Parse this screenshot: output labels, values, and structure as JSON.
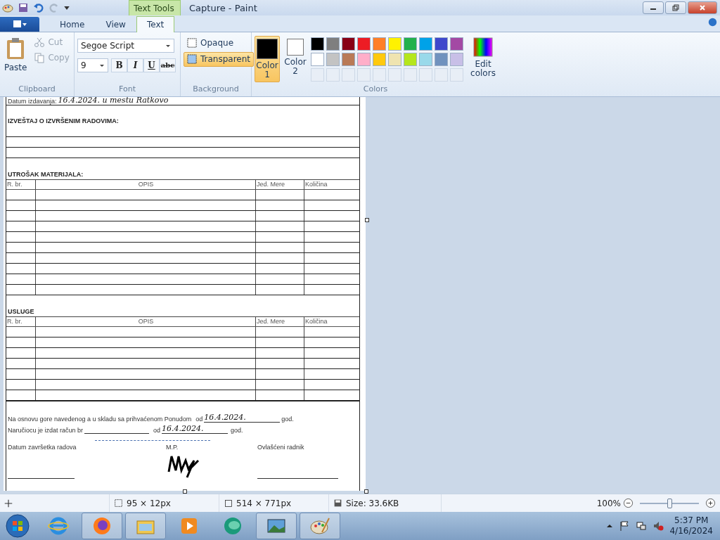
{
  "window": {
    "title": "Capture - Paint",
    "context_tab": "Text Tools"
  },
  "ribbon_tabs": [
    {
      "label": "Home",
      "selected": false
    },
    {
      "label": "View",
      "selected": false
    },
    {
      "label": "Text",
      "selected": true
    }
  ],
  "clipboard": {
    "label": "Clipboard",
    "paste": "Paste",
    "cut": "Cut",
    "copy": "Copy"
  },
  "font": {
    "label": "Font",
    "family": "Segoe Script",
    "size": "9",
    "styles": [
      {
        "kind": "bold",
        "label": "B"
      },
      {
        "kind": "italic",
        "label": "I"
      },
      {
        "kind": "underline",
        "label": "U"
      },
      {
        "kind": "strike",
        "label": "abc"
      }
    ]
  },
  "background": {
    "label": "Background",
    "options": [
      {
        "label": "Opaque",
        "selected": false
      },
      {
        "label": "Transparent",
        "selected": true
      }
    ]
  },
  "colors": {
    "label": "Colors",
    "edit": "Edit colors",
    "slots": [
      {
        "label": "Color 1",
        "color": "#000000",
        "selected": true
      },
      {
        "label": "Color 2",
        "color": "#ffffff",
        "selected": false
      }
    ],
    "palette": [
      {
        "color": "#000000"
      },
      {
        "color": "#7f7f7f"
      },
      {
        "color": "#880015"
      },
      {
        "color": "#ed1c24"
      },
      {
        "color": "#ff7f27"
      },
      {
        "color": "#fff200"
      },
      {
        "color": "#22b14c"
      },
      {
        "color": "#00a2e8"
      },
      {
        "color": "#3f48cc"
      },
      {
        "color": "#a349a4"
      },
      {
        "color": "#ffffff"
      },
      {
        "color": "#c3c3c3"
      },
      {
        "color": "#b97a57"
      },
      {
        "color": "#ffaec9"
      },
      {
        "color": "#ffc90e"
      },
      {
        "color": "#efe4b0"
      },
      {
        "color": "#b5e61d"
      },
      {
        "color": "#99d9ea"
      },
      {
        "color": "#7092be"
      },
      {
        "color": "#c8bfe7"
      }
    ]
  },
  "document": {
    "issue_label": "Datum izdavanja:",
    "issue_value": "16.4.2024. u mestu Ratkovo",
    "report_heading": "IZVEŠTAJ O IZVRŠENIM RADOVIMA:",
    "tables": [
      {
        "heading": "UTROŠAK MATERIJALA:",
        "columns": [
          "R. br.",
          "OPIS",
          "Jed. Mere",
          "Količina"
        ]
      },
      {
        "heading": "USLUGE",
        "columns": [
          "R. br.",
          "OPIS",
          "Jed. Mere",
          "Količina"
        ]
      }
    ],
    "basis": {
      "text": "Na osnovu gore navedenog a u skladu sa prihvaćenom Ponudom",
      "from": "od",
      "date": "16.4.2024.",
      "suffix": "god."
    },
    "invoice": {
      "text": "Naručiocu je izdat račun br",
      "from": "od",
      "date": "16.4.2024.",
      "suffix": "god."
    },
    "signatures": [
      "Datum završetka radova",
      "M.P.",
      "Ovlašćeni radnik"
    ]
  },
  "status_bar": {
    "selection": "95 × 12px",
    "image_size": "514 × 771px",
    "file_size": "Size: 33.6KB",
    "zoom": "100%",
    "level": 0.5
  },
  "taskbar": {
    "time": "5:37 PM",
    "date": "4/16/2024"
  }
}
